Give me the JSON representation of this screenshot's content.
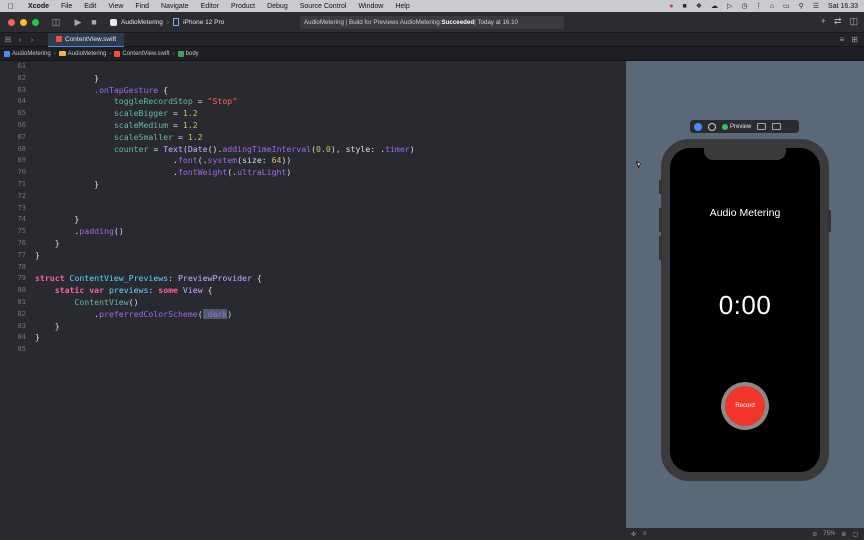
{
  "menubar": {
    "app": "Xcode",
    "menus": [
      "File",
      "Edit",
      "View",
      "Find",
      "Navigate",
      "Editor",
      "Product",
      "Debug",
      "Source Control",
      "Window",
      "Help"
    ],
    "clock": "Sat 16.33"
  },
  "toolbar": {
    "scheme": "AudioMetering",
    "device": "iPhone 12 Pro",
    "activity_prefix": "AudioMetering | Build for Previews AudioMetering: ",
    "activity_status": "Succeeded",
    "activity_suffix": " | Today at 16.10"
  },
  "tab": {
    "label": "ContentView.swift"
  },
  "jumpbar": {
    "crumbs": [
      "AudioMetering",
      "AudioMetering",
      "ContentView.swift",
      "body"
    ]
  },
  "editor": {
    "line_numbers": [
      "61",
      "62",
      "63",
      "64",
      "65",
      "66",
      "67",
      "68",
      "69",
      "70",
      "71",
      "72",
      "73",
      "74",
      "75",
      "76",
      "77",
      "78",
      "79",
      "80",
      "81",
      "82",
      "83",
      "84",
      "85"
    ]
  },
  "canvas": {
    "preview_label": "Preview",
    "zoom": "75%"
  },
  "app_preview": {
    "title": "Audio Metering",
    "timer": "0:00",
    "record_label": "Record"
  }
}
